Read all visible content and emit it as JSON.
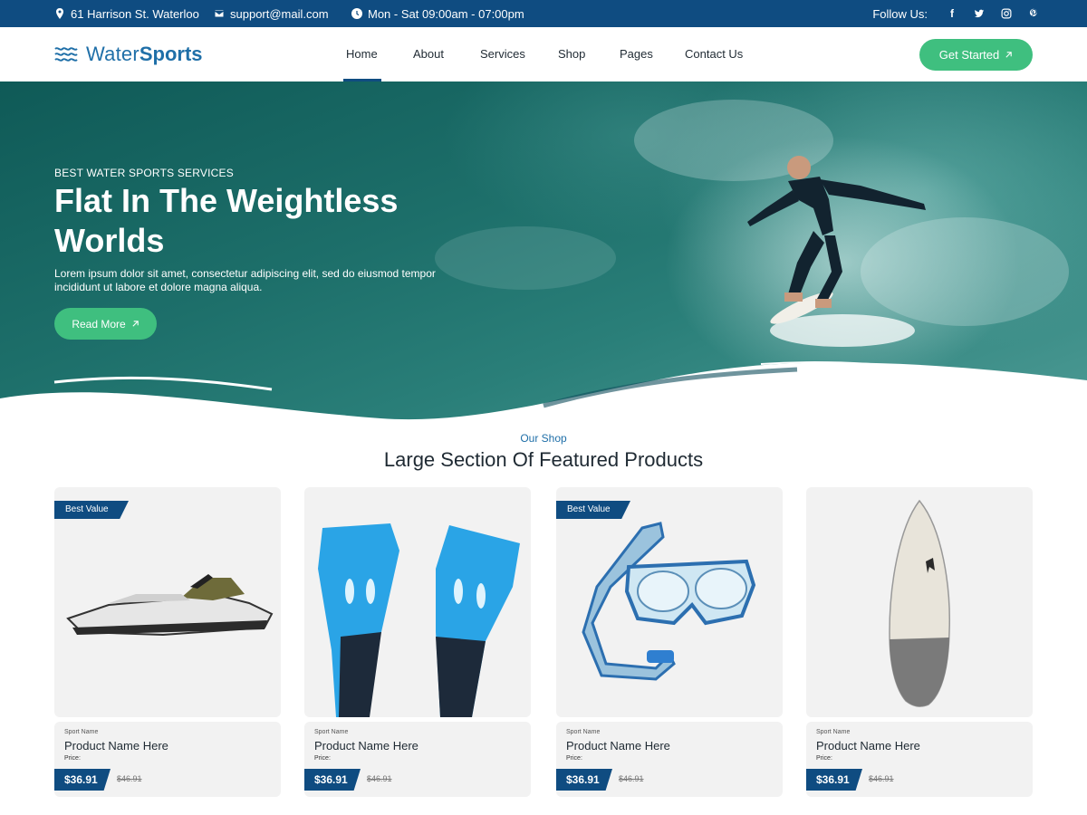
{
  "topbar": {
    "address": "61 Harrison St. Waterloo",
    "email": "support@mail.com",
    "hours": "Mon - Sat 09:00am - 07:00pm",
    "follow_label": "Follow Us:",
    "socials": [
      "facebook-icon",
      "twitter-icon",
      "instagram-icon",
      "pinterest-icon"
    ],
    "bg_color": "#0f4c81"
  },
  "header": {
    "logo_part1": "Water",
    "logo_part2": "Sports",
    "nav": [
      "Home",
      "About",
      "Services",
      "Shop",
      "Pages",
      "Contact Us"
    ],
    "active_nav": "Home",
    "cta_label": "Get Started",
    "accent_color": "#3fbf7f"
  },
  "hero": {
    "eyebrow": "BEST WATER SPORTS SERVICES",
    "title": "Flat In The Weightless Worlds",
    "description": "Lorem ipsum dolor sit amet, consectetur adipiscing elit, sed do eiusmod tempor incididunt ut labore et dolore magna aliqua.",
    "button_label": "Read More"
  },
  "shop": {
    "subtitle": "Our Shop",
    "title": "Large Section Of Featured Products",
    "products": [
      {
        "image": "jet-ski",
        "badge": "Best Value",
        "sport": "Sport Name",
        "name": "Product Name Here",
        "price_label": "Price:",
        "price": "$36.91",
        "old_price": "$46.91"
      },
      {
        "image": "swim-fins",
        "badge": "",
        "sport": "Sport Name",
        "name": "Product Name Here",
        "price_label": "Price:",
        "price": "$36.91",
        "old_price": "$46.91"
      },
      {
        "image": "snorkel-mask",
        "badge": "Best Value",
        "sport": "Sport Name",
        "name": "Product Name Here",
        "price_label": "Price:",
        "price": "$36.91",
        "old_price": "$46.91"
      },
      {
        "image": "surfboard",
        "badge": "",
        "sport": "Sport Name",
        "name": "Product Name Here",
        "price_label": "Price:",
        "price": "$36.91",
        "old_price": "$46.91"
      }
    ]
  }
}
